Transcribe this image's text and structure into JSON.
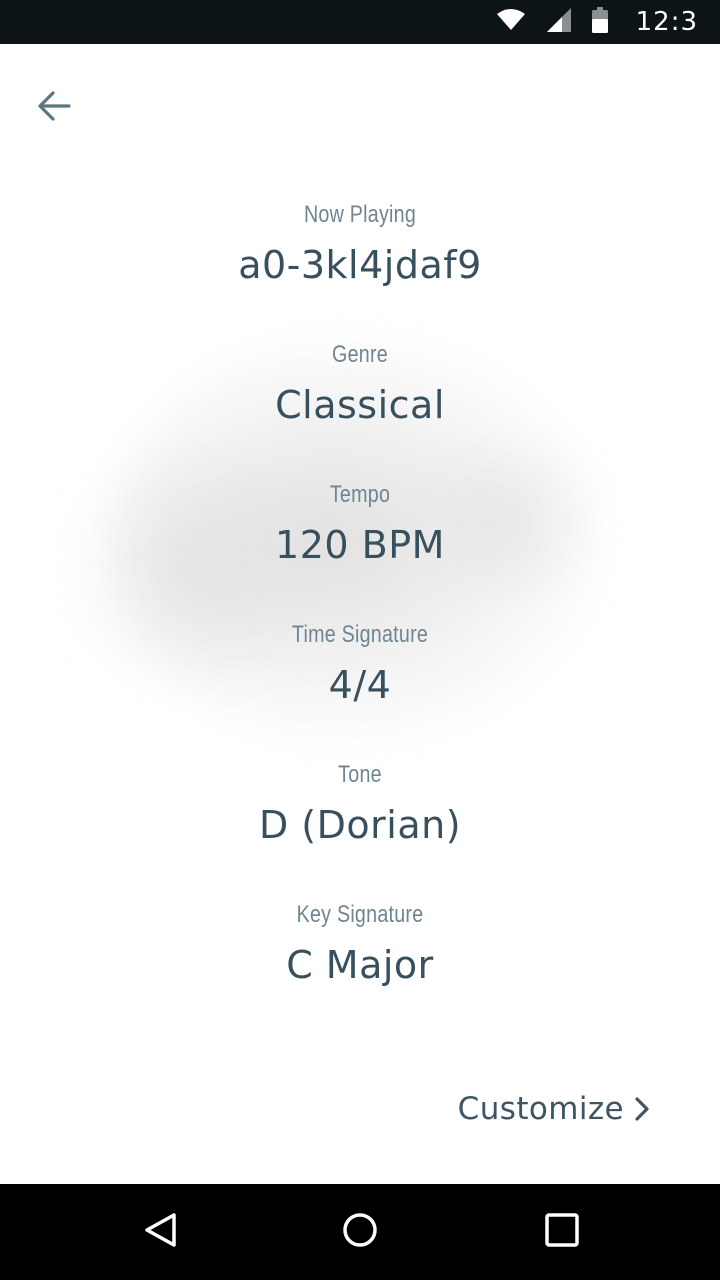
{
  "status_bar": {
    "time": "12:3",
    "icons": [
      "wifi-icon",
      "signal-icon",
      "battery-icon"
    ]
  },
  "header": {
    "back_icon": "arrow-left-icon"
  },
  "info": {
    "now_playing": {
      "label": "Now Playing",
      "value": "a0-3kl4jdaf9"
    },
    "genre": {
      "label": "Genre",
      "value": "Classical"
    },
    "tempo": {
      "label": "Tempo",
      "value": "120 BPM"
    },
    "time_signature": {
      "label": "Time Signature",
      "value": "4/4"
    },
    "tone": {
      "label": "Tone",
      "value": "D (Dorian)"
    },
    "key_signature": {
      "label": "Key Signature",
      "value": "C Major"
    }
  },
  "actions": {
    "customize_label": "Customize",
    "customize_icon": "chevron-right-icon"
  },
  "nav_bar": {
    "icons": [
      "back-triangle-icon",
      "home-circle-icon",
      "recents-square-icon"
    ]
  },
  "colors": {
    "label": "#6f8591",
    "value": "#38505e",
    "status_bar": "#0d1417",
    "nav_bar": "#000000"
  }
}
